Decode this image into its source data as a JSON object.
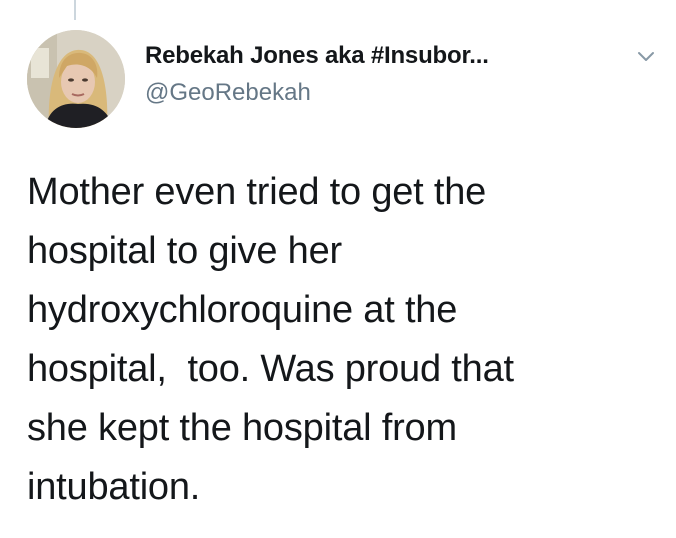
{
  "author": {
    "display_name": "Rebekah Jones aka #Insubor...",
    "handle": "@GeoRebekah"
  },
  "icons": {
    "menu": "chevron-down-icon",
    "avatar": "profile-photo"
  },
  "colors": {
    "text_primary": "#14171a",
    "text_secondary": "#657786",
    "thread_line": "#ccd6dd"
  },
  "tweet": {
    "text": "Mother even tried to get the\nhospital to give her\nhydroxychloroquine at the\nhospital,  too. Was proud that\nshe kept the hospital from\nintubation."
  }
}
